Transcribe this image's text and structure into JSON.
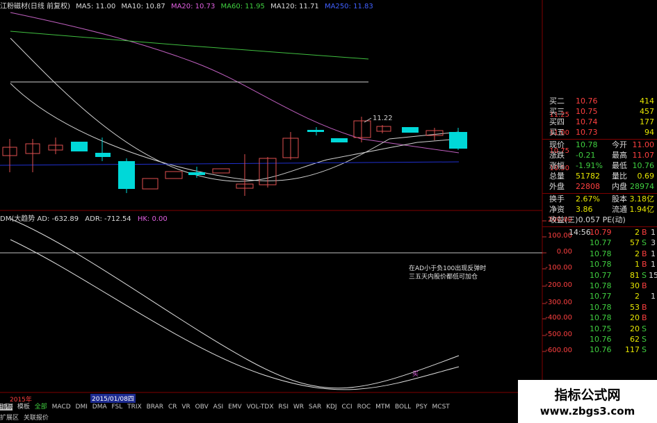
{
  "header": {
    "stock_title": "江粉磁材(日线 前复权)",
    "ma5": "MA5: 11.00",
    "ma10": "MA10: 10.87",
    "ma20": "MA20: 10.73",
    "ma60": "MA60: 11.95",
    "ma120": "MA120: 11.71",
    "ma250": "MA250: 11.83"
  },
  "price_axis": [
    "11.25",
    "11.00",
    "10.75",
    "10.50"
  ],
  "peak_label": "11.22",
  "indicator_header": {
    "name": "DM(大趋势",
    "ad": "AD: -632.89",
    "adr": "ADR: -712.54",
    "hk": "HK: 0.00"
  },
  "indicator_axis": [
    "200.00",
    "100.00",
    "0.00",
    "-100.00",
    "-200.00",
    "-300.00",
    "-400.00",
    "-500.00",
    "-600.00"
  ],
  "annotation_line1": "在AD小于负100出现反弹时",
  "annotation_line2": "三五天内股价都低可加仓",
  "signal_label": "买",
  "order_book": [
    {
      "label": "买二",
      "price": "10.76",
      "vol": "414"
    },
    {
      "label": "买三",
      "price": "10.75",
      "vol": "457"
    },
    {
      "label": "买四",
      "price": "10.74",
      "vol": "177"
    },
    {
      "label": "买五",
      "price": "10.73",
      "vol": "94"
    }
  ],
  "quote": [
    {
      "l1": "现价",
      "v1": "10.78",
      "l2": "今开",
      "v2": "11.00"
    },
    {
      "l1": "涨跌",
      "v1": "-0.21",
      "l2": "最高",
      "v2": "11.07"
    },
    {
      "l1": "涨幅",
      "v1": "-1.91%",
      "l2": "最低",
      "v2": "10.76"
    },
    {
      "l1": "总量",
      "v1": "51782",
      "l2": "量比",
      "v2": "0.69"
    },
    {
      "l1": "外盘",
      "v1": "22808",
      "l2": "内盘",
      "v2": "28974"
    },
    {
      "l1": "换手",
      "v1": "2.67%",
      "l2": "股本",
      "v2": "3.18亿"
    },
    {
      "l1": "净资",
      "v1": "3.86",
      "l2": "流通",
      "v2": "1.94亿"
    }
  ],
  "earnings": "收益(三)0.057 PE(动)",
  "ticks": [
    {
      "time": "14:56",
      "price": "10.79",
      "vol": "2",
      "side": "B"
    },
    {
      "time": "",
      "price": "10.77",
      "vol": "57",
      "side": "S"
    },
    {
      "time": "",
      "price": "10.78",
      "vol": "2",
      "side": "B"
    },
    {
      "time": "",
      "price": "10.78",
      "vol": "1",
      "side": "B"
    },
    {
      "time": "",
      "price": "10.77",
      "vol": "81",
      "side": "S"
    },
    {
      "time": "",
      "price": "10.78",
      "vol": "30",
      "side": "B"
    },
    {
      "time": "",
      "price": "10.77",
      "vol": "2",
      "side": ""
    },
    {
      "time": "",
      "price": "10.78",
      "vol": "53",
      "side": "B"
    },
    {
      "time": "",
      "price": "10.78",
      "vol": "20",
      "side": "B"
    },
    {
      "time": "",
      "price": "10.75",
      "vol": "20",
      "side": "S"
    },
    {
      "time": "",
      "price": "10.76",
      "vol": "62",
      "side": "S"
    },
    {
      "time": "",
      "price": "10.76",
      "vol": "117",
      "side": "S"
    }
  ],
  "tick_side_marks": [
    "1",
    "3",
    "1",
    "1",
    "15",
    "",
    "1",
    "",
    "",
    "",
    "",
    ""
  ],
  "time_axis": {
    "year": "2015年",
    "date": "2015/01/08四"
  },
  "indicator_tabs": [
    "指标",
    "模板",
    "全部",
    "MACD",
    "DMI",
    "DMA",
    "FSL",
    "TRIX",
    "BRAR",
    "CR",
    "VR",
    "OBV",
    "ASI",
    "EMV",
    "VOL-TDX",
    "RSI",
    "WR",
    "SAR",
    "KDJ",
    "CCI",
    "ROC",
    "MTM",
    "BOLL",
    "PSY",
    "MCST"
  ],
  "bottom_links": [
    "扩展区",
    "关联报价"
  ],
  "watermark": {
    "title": "指标公式网",
    "url": "www.zbgs3.com"
  }
}
